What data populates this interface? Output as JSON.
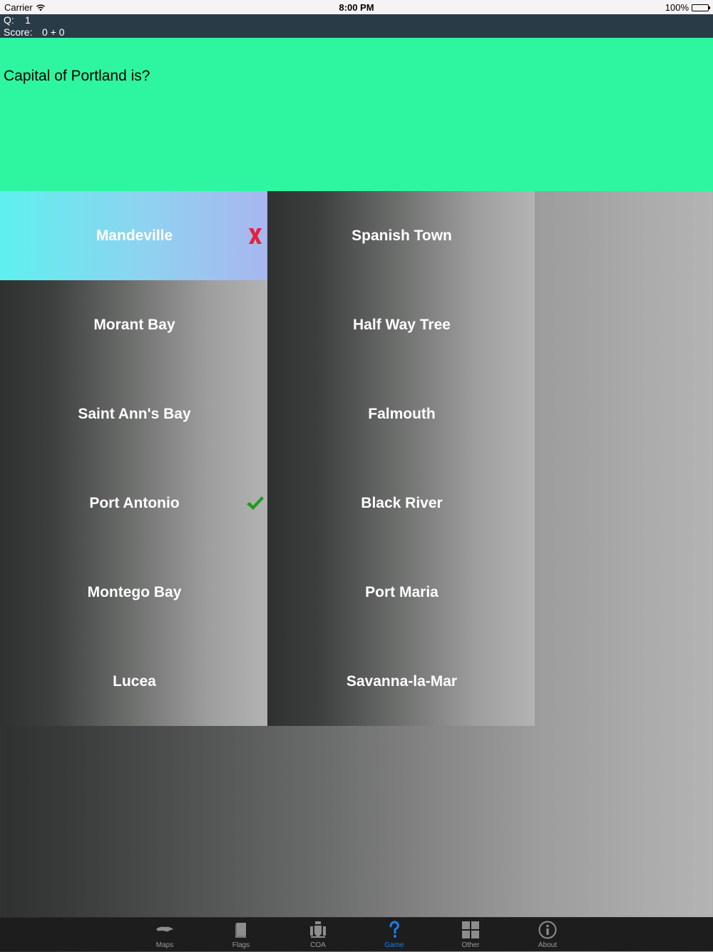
{
  "status_bar": {
    "carrier": "Carrier",
    "time": "8:00 PM",
    "battery": "100%"
  },
  "scorebar": {
    "q_label": "Q:",
    "q_value": "1",
    "score_label": "Score:",
    "score_value": "0 + 0"
  },
  "question": {
    "text": "Capital of Portland is?"
  },
  "answers": [
    {
      "label": "Mandeville",
      "state": "wrong"
    },
    {
      "label": "Spanish Town",
      "state": "none"
    },
    {
      "label": "Morant Bay",
      "state": "none"
    },
    {
      "label": "Half Way Tree",
      "state": "none"
    },
    {
      "label": "Saint Ann's Bay",
      "state": "none"
    },
    {
      "label": "Falmouth",
      "state": "none"
    },
    {
      "label": "Port Antonio",
      "state": "correct"
    },
    {
      "label": "Black River",
      "state": "none"
    },
    {
      "label": "Montego Bay",
      "state": "none"
    },
    {
      "label": "Port Maria",
      "state": "none"
    },
    {
      "label": "Lucea",
      "state": "none"
    },
    {
      "label": "Savanna-la-Mar",
      "state": "none"
    }
  ],
  "tabs": [
    {
      "label": "Maps",
      "icon": "map-icon"
    },
    {
      "label": "Flags",
      "icon": "flag-icon"
    },
    {
      "label": "COA",
      "icon": "coat-of-arms-icon"
    },
    {
      "label": "Game",
      "icon": "question-mark-icon",
      "active": true
    },
    {
      "label": "Other",
      "icon": "grid-icon"
    },
    {
      "label": "About",
      "icon": "info-icon"
    }
  ],
  "colors": {
    "question_bg": "#2ef6a0",
    "scorebar_bg": "#2a3b48",
    "active_tab": "#1a7fef",
    "wrong_mark": "#e8203a",
    "correct_mark": "#1f9a1f"
  }
}
